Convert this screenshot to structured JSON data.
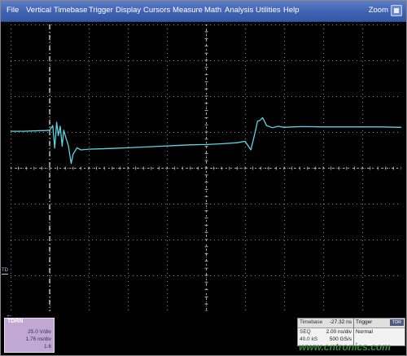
{
  "menu": [
    "File",
    "Vertical",
    "Timebase",
    "Trigger",
    "Display",
    "Cursors",
    "Measure",
    "Math",
    "Analysis",
    "Utilities",
    "Help"
  ],
  "zoom_label": "Zoom",
  "channel": {
    "name": "TDRN",
    "volts_per_div": "25.0 V/div",
    "time_per_div": "1.76 ns/div",
    "extra": "1.6"
  },
  "reference_marker": "TD",
  "timebase": {
    "label": "Timebase",
    "value": "-27.32 ns",
    "mode": "SEQ",
    "time_per_div": "2.00 ns/div",
    "samples": "40.0 kS",
    "sample_rate": "500 GS/s"
  },
  "trigger": {
    "label": "Trigger",
    "badge": "TDR",
    "mode": "Normal"
  },
  "watermark": "www.cntronics.com",
  "colors": {
    "trace": "#5fd3e0",
    "grid": "#8a8a8a",
    "menubar": "#3f62b3",
    "channel_panel": "#c1a7d4"
  },
  "chart_data": {
    "type": "line",
    "title": "",
    "xlabel": "",
    "ylabel": "",
    "grid": true,
    "divisions": {
      "x": 10,
      "y": 8
    },
    "xlim": [
      0,
      10
    ],
    "ylim": [
      -4,
      4
    ],
    "trigger_marker_div": 1.0,
    "series": [
      {
        "x": [
          0,
          0.3,
          0.6,
          0.9,
          1.0,
          1.08,
          1.13,
          1.18,
          1.22,
          1.27,
          1.32,
          1.36,
          1.42,
          1.48,
          1.55,
          1.6,
          1.7,
          1.8,
          2,
          2.3,
          2.6,
          3,
          3.4,
          3.8,
          4.2,
          4.6,
          5,
          5.4,
          5.8,
          6.0,
          6.15,
          6.25,
          6.32,
          6.38,
          6.45,
          6.55,
          6.7,
          6.85,
          7,
          7.2,
          7.5,
          8,
          8.5,
          9,
          9.5,
          10
        ],
        "values": [
          1.02,
          1.02,
          1.03,
          1.04,
          1.05,
          1.18,
          0.55,
          1.27,
          0.9,
          1.16,
          0.6,
          1.05,
          0.82,
          0.62,
          0.12,
          0.38,
          0.56,
          0.5,
          0.52,
          0.53,
          0.54,
          0.56,
          0.58,
          0.6,
          0.62,
          0.64,
          0.65,
          0.67,
          0.7,
          0.74,
          0.5,
          0.95,
          1.3,
          1.32,
          1.4,
          1.18,
          1.12,
          1.16,
          1.13,
          1.14,
          1.15,
          1.14,
          1.14,
          1.14,
          1.14,
          1.13
        ]
      }
    ]
  }
}
